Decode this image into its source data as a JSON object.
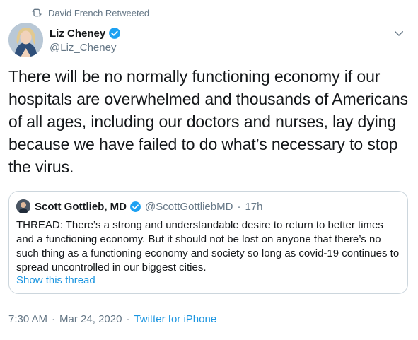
{
  "retweet": {
    "icon": "retweet-icon",
    "label": "David French Retweeted"
  },
  "author": {
    "name": "Liz Cheney",
    "handle": "@Liz_Cheney",
    "verified": true,
    "avatar_icon": "avatar-liz-cheney"
  },
  "menu": {
    "icon": "chevron-down-icon"
  },
  "tweet": {
    "text": "There will be no normally functioning economy if our hospitals are overwhelmed and thousands of Americans of all ages, including our doctors and nurses, lay dying because we have failed to do what’s necessary to stop the virus."
  },
  "quote": {
    "name": "Scott Gottlieb, MD",
    "handle": "@ScottGottliebMD",
    "dot": "·",
    "time": "17h",
    "verified": true,
    "text": "THREAD: There’s a strong and understandable desire to return to better times and a functioning economy. But it should not be lost on anyone that there’s no such thing as a functioning economy and society so long as covid-19 continues to spread uncontrolled in our biggest cities.",
    "link_label": "Show this thread"
  },
  "footer": {
    "time": "7:30 AM",
    "dot1": "·",
    "date": "Mar 24, 2020",
    "dot2": "·",
    "source": "Twitter for iPhone"
  },
  "colors": {
    "text": "#14171a",
    "muted": "#657786",
    "link": "#1b95e0",
    "verified": "#1da1f2",
    "border": "#ccd6dd"
  }
}
